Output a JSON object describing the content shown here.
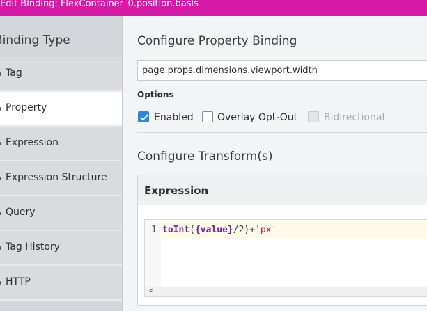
{
  "window": {
    "title": "Edit Binding: FlexContainer_0.position.basis"
  },
  "sidebar": {
    "header": "Binding Type",
    "items": [
      {
        "label": "Tag"
      },
      {
        "label": "Property"
      },
      {
        "label": "Expression"
      },
      {
        "label": "Expression Structure"
      },
      {
        "label": "Query"
      },
      {
        "label": "Tag History"
      },
      {
        "label": "HTTP"
      }
    ],
    "active": "Property"
  },
  "binding": {
    "heading": "Configure Property Binding",
    "path_value": "page.props.dimensions.viewport.width",
    "options_label": "Options",
    "options": {
      "enabled": {
        "label": "Enabled",
        "checked": true
      },
      "overlay_opt_out": {
        "label": "Overlay Opt-Out",
        "checked": false
      },
      "bidirectional": {
        "label": "Bidirectional",
        "checked": false,
        "disabled": true
      }
    }
  },
  "transforms": {
    "heading": "Configure Transform(s)",
    "expression": {
      "title": "Expression",
      "line_number": "1",
      "code_tokens": {
        "fn": "toInt",
        "open": "(",
        "var": "{value}",
        "rest": "/2)+",
        "str": "'px'"
      },
      "scroll_left": "<"
    }
  },
  "colors": {
    "titlebar": "#d61aa8",
    "checkbox_checked": "#2f86d6"
  }
}
